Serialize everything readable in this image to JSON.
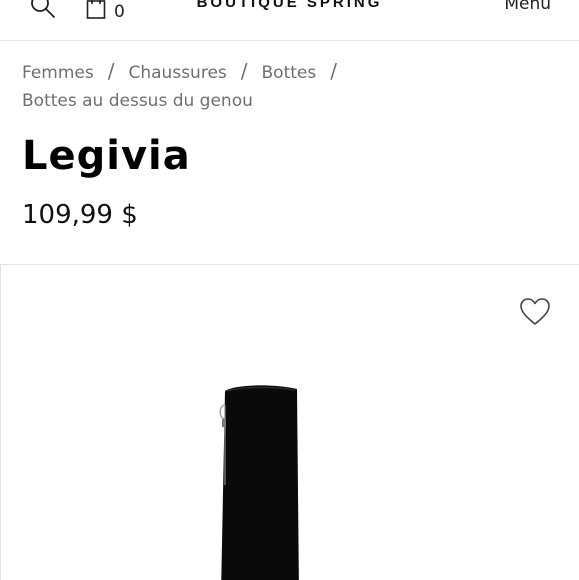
{
  "header": {
    "cart_count": "0",
    "brand": "BOUTIQUE SPRING",
    "menu_label": "Menu"
  },
  "breadcrumb": {
    "items": [
      "Femmes",
      "Chaussures",
      "Bottes",
      "Bottes au dessus du genou"
    ],
    "separator": "/"
  },
  "product": {
    "name": "Legivia",
    "price": "109,99 $"
  },
  "icons": {
    "search": "search-icon",
    "bag": "shopping-bag-icon",
    "favorite": "heart-icon"
  },
  "colors": {
    "text": "#111111",
    "muted": "#6f6f6f",
    "divider": "#e3e3e3"
  }
}
